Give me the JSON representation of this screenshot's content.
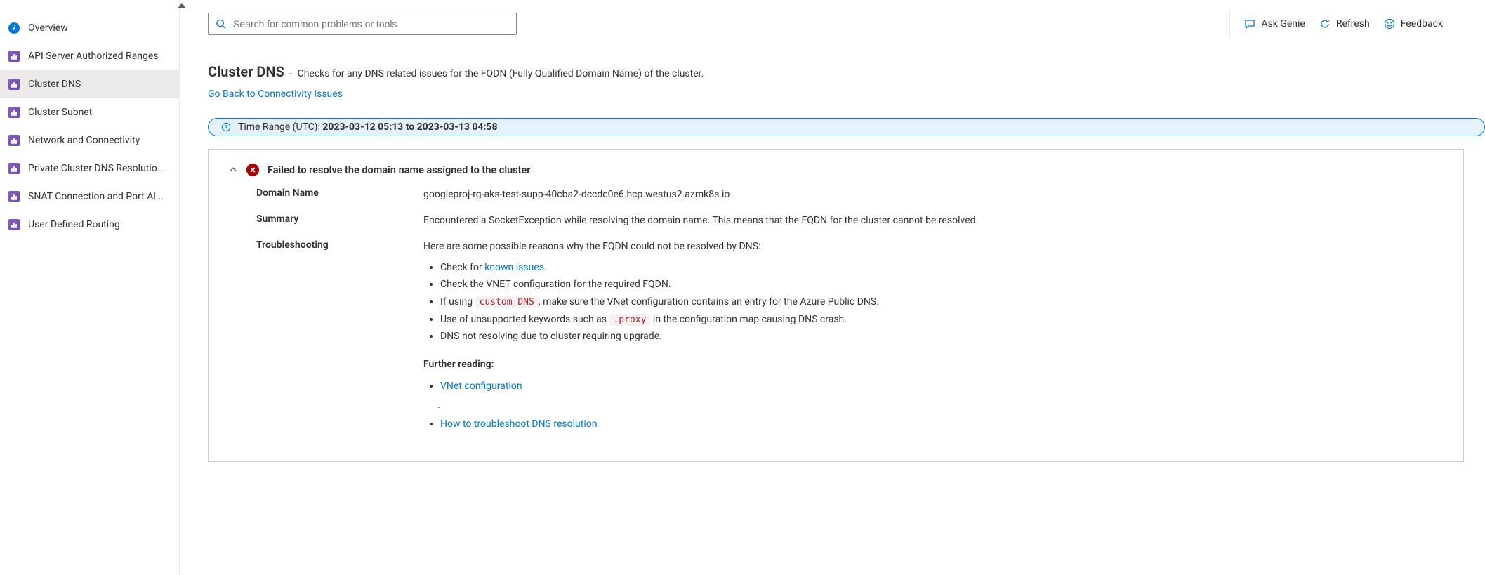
{
  "sidebar": {
    "overview": "Overview",
    "items": [
      "API Server Authorized Ranges",
      "Cluster DNS",
      "Cluster Subnet",
      "Network and Connectivity",
      "Private Cluster DNS Resolutio...",
      "SNAT Connection and Port Al...",
      "User Defined Routing"
    ],
    "selected_index": 1
  },
  "toolbar": {
    "search_placeholder": "Search for common problems or tools",
    "ask_genie": "Ask Genie",
    "refresh": "Refresh",
    "feedback": "Feedback"
  },
  "header": {
    "title": "Cluster DNS",
    "description": "Checks for any DNS related issues for the FQDN (Fully Qualified Domain Name) of the cluster.",
    "back_link": "Go Back to Connectivity Issues"
  },
  "time_range": {
    "label": "Time Range (UTC): ",
    "value": "2023-03-12 05:13 to 2023-03-13 04:58"
  },
  "result": {
    "title": "Failed to resolve the domain name assigned to the cluster",
    "domain_name_label": "Domain Name",
    "domain_name_value": "googleproj-rg-aks-test-supp-40cba2-dccdc0e6.hcp.westus2.azmk8s.io",
    "summary_label": "Summary",
    "summary_value": "Encountered a SocketException while resolving the domain name. This means that the FQDN for the cluster cannot be resolved.",
    "troubleshooting_label": "Troubleshooting",
    "troubleshooting_intro": "Here are some possible reasons why the FQDN could not be resolved by DNS:",
    "reasons": {
      "r1_pre": "Check for ",
      "r1_link": "known issues",
      "r1_post": ".",
      "r2": "Check the VNET configuration for the required FQDN.",
      "r3_pre": "If using ",
      "r3_code": "custom DNS",
      "r3_post": ", make sure the VNet configuration contains an entry for the Azure Public DNS.",
      "r4_pre": "Use of unsupported keywords such as ",
      "r4_code": ".proxy",
      "r4_post": " in the configuration map causing DNS crash.",
      "r5": "DNS not resolving due to cluster requiring upgrade."
    },
    "further_reading_label": "Further reading:",
    "further_reading": {
      "l1": "VNet configuration",
      "dot": ".",
      "l2": "How to troubleshoot DNS resolution"
    }
  }
}
